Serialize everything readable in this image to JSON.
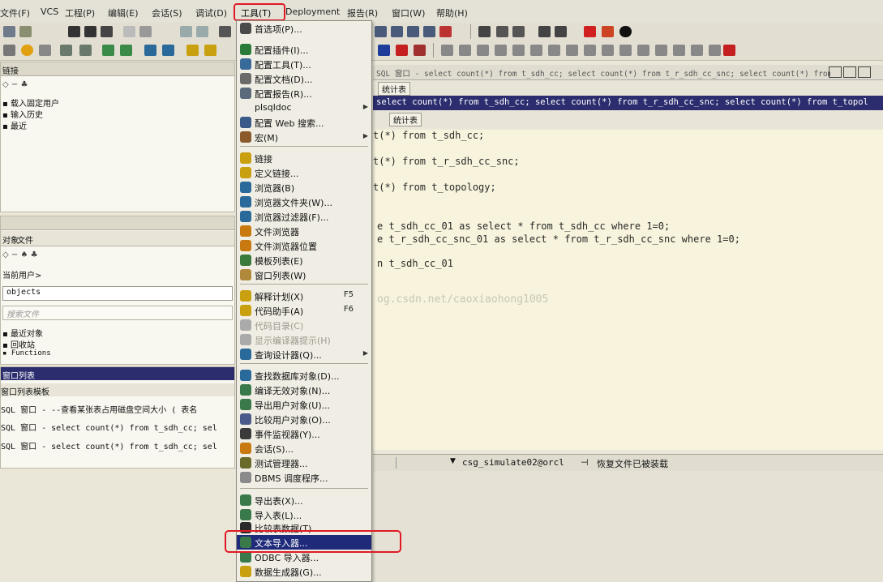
{
  "menubar": {
    "items": [
      "文件(F)",
      "VCS",
      "工程(P)",
      "编辑(E)",
      "会话(S)",
      "调试(D)",
      "工具(T)",
      "Deployment",
      "报告(R)",
      "窗口(W)",
      "帮助(H)"
    ]
  },
  "tools_menu": {
    "items": [
      {
        "label": "首选项(P)...",
        "shortcut": "",
        "submenu": false,
        "disabled": false,
        "icon": "wrench-icon"
      },
      {
        "label": "配置插件(I)...",
        "shortcut": "",
        "submenu": false,
        "disabled": false,
        "icon": "plugin-icon"
      },
      {
        "label": "配置工具(T)...",
        "shortcut": "",
        "submenu": false,
        "disabled": false,
        "icon": "tools-icon"
      },
      {
        "label": "配置文档(D)...",
        "shortcut": "",
        "submenu": false,
        "disabled": false,
        "icon": "document-icon"
      },
      {
        "label": "配置报告(R)...",
        "shortcut": "",
        "submenu": false,
        "disabled": false,
        "icon": "report-icon"
      },
      {
        "label": "plsqldoc",
        "shortcut": "",
        "submenu": true,
        "disabled": false,
        "icon": ""
      },
      {
        "label": "配置 Web 搜索...",
        "shortcut": "",
        "submenu": false,
        "disabled": false,
        "icon": "web-search-icon"
      },
      {
        "label": "宏(M)",
        "shortcut": "",
        "submenu": true,
        "disabled": false,
        "icon": "macro-icon"
      },
      {
        "label": "链接",
        "shortcut": "",
        "submenu": false,
        "disabled": false,
        "icon": "database-link-icon"
      },
      {
        "label": "定义链接...",
        "shortcut": "",
        "submenu": false,
        "disabled": false,
        "icon": "database-link-define-icon"
      },
      {
        "label": "浏览器(B)",
        "shortcut": "",
        "submenu": false,
        "disabled": false,
        "icon": "browser-icon"
      },
      {
        "label": "浏览器文件夹(W)...",
        "shortcut": "",
        "submenu": false,
        "disabled": false,
        "icon": "browser-folder-icon"
      },
      {
        "label": "浏览器过滤器(F)...",
        "shortcut": "",
        "submenu": false,
        "disabled": false,
        "icon": "browser-filter-icon"
      },
      {
        "label": "文件浏览器",
        "shortcut": "",
        "submenu": false,
        "disabled": false,
        "icon": "file-browser-icon"
      },
      {
        "label": "文件浏览器位置",
        "shortcut": "",
        "submenu": false,
        "disabled": false,
        "icon": "file-browser-location-icon"
      },
      {
        "label": "模板列表(E)",
        "shortcut": "",
        "submenu": false,
        "disabled": false,
        "icon": "template-list-icon"
      },
      {
        "label": "窗口列表(W)",
        "shortcut": "",
        "submenu": false,
        "disabled": false,
        "icon": "window-list-icon"
      },
      {
        "label": "解释计划(X)",
        "shortcut": "F5",
        "submenu": false,
        "disabled": false,
        "icon": "explain-plan-icon"
      },
      {
        "label": "代码助手(A)",
        "shortcut": "F6",
        "submenu": false,
        "disabled": false,
        "icon": "code-assistant-icon"
      },
      {
        "label": "代码目录(C)",
        "shortcut": "",
        "submenu": false,
        "disabled": true,
        "icon": "code-contents-icon"
      },
      {
        "label": "显示编译器提示(H)",
        "shortcut": "",
        "submenu": false,
        "disabled": true,
        "icon": "compiler-hint-icon"
      },
      {
        "label": "查询设计器(Q)...",
        "shortcut": "",
        "submenu": true,
        "disabled": false,
        "icon": "query-designer-icon"
      },
      {
        "label": "查找数据库对象(D)...",
        "shortcut": "",
        "submenu": false,
        "disabled": false,
        "icon": "find-object-icon"
      },
      {
        "label": "编译无效对象(N)...",
        "shortcut": "",
        "submenu": false,
        "disabled": false,
        "icon": "compile-invalid-icon"
      },
      {
        "label": "导出用户对象(U)...",
        "shortcut": "",
        "submenu": false,
        "disabled": false,
        "icon": "export-user-objects-icon"
      },
      {
        "label": "比较用户对象(O)...",
        "shortcut": "",
        "submenu": false,
        "disabled": false,
        "icon": "compare-user-objects-icon"
      },
      {
        "label": "事件监视器(Y)...",
        "shortcut": "",
        "submenu": false,
        "disabled": false,
        "icon": "event-monitor-icon"
      },
      {
        "label": "会话(S)...",
        "shortcut": "",
        "submenu": false,
        "disabled": false,
        "icon": "sessions-icon"
      },
      {
        "label": "测试管理器...",
        "shortcut": "",
        "submenu": false,
        "disabled": false,
        "icon": "test-manager-icon"
      },
      {
        "label": "DBMS 调度程序...",
        "shortcut": "",
        "submenu": false,
        "disabled": false,
        "icon": "scheduler-icon"
      },
      {
        "label": "导出表(X)...",
        "shortcut": "",
        "submenu": false,
        "disabled": false,
        "icon": "export-tables-icon"
      },
      {
        "label": "导入表(L)...",
        "shortcut": "",
        "submenu": false,
        "disabled": false,
        "icon": "import-tables-icon"
      },
      {
        "label": "比较表数据(T)...",
        "shortcut": "",
        "submenu": false,
        "disabled": false,
        "icon": "compare-table-data-icon"
      },
      {
        "label": "文本导入器...",
        "shortcut": "",
        "submenu": false,
        "disabled": false,
        "selected": true,
        "icon": "text-importer-icon"
      },
      {
        "label": "ODBC 导入器...",
        "shortcut": "",
        "submenu": false,
        "disabled": false,
        "icon": "odbc-importer-icon"
      },
      {
        "label": "数据生成器(G)...",
        "shortcut": "",
        "submenu": false,
        "disabled": false,
        "icon": "data-generator-icon"
      }
    ]
  },
  "left": {
    "top_header": "链接",
    "tree_items": [
      "载入固定用户",
      "输入历史",
      "最近"
    ],
    "tabs": [
      "对象",
      "文件"
    ],
    "current_user": "当前用户>",
    "filter": "objects",
    "search": "搜索文件",
    "object_items": [
      "最近对象",
      "回收站",
      "Functions"
    ],
    "window_list_title": "窗口列表",
    "window_tabs": [
      "窗口列表",
      "模板"
    ],
    "window_rows": [
      "SQL 窗口 - --查看某张表占用磁盘空间大小 ( 表名",
      "SQL 窗口 - select count(*) from t_sdh_cc; sel",
      "SQL 窗口 - select count(*) from t_sdh_cc; sel"
    ]
  },
  "editor": {
    "window_title": "SQL 窗口 - select count(*) from t_sdh_cc; select count(*) from t_r_sdh_cc_snc; select count(*) from",
    "tab1": "统计表",
    "header_text": "select count(*) from t_sdh_cc; select count(*) from t_r_sdh_cc_snc; select count(*) from t_topol",
    "tab2": "统计表",
    "code_lines": [
      "t(*) from t_sdh_cc;",
      "t(*) from t_r_sdh_cc_snc;",
      "t(*) from t_topology;",
      "e t_sdh_cc_01 as select * from t_sdh_cc where 1=0;",
      "e t_r_sdh_cc_snc_01 as select * from t_r_sdh_cc_snc where 1=0;",
      "n t_sdh_cc_01"
    ],
    "watermark": "og.csdn.net/caoxiaohong1005"
  },
  "status": {
    "connection": "csg_simulate02@orcl",
    "message": "恢复文件已被装载"
  },
  "colors": {
    "highlight_border": "#e01a24",
    "selected_item_bg": "#1f2a7a",
    "editor_bg": "#f7f3dd",
    "title_bar": "#2b2d6e"
  }
}
